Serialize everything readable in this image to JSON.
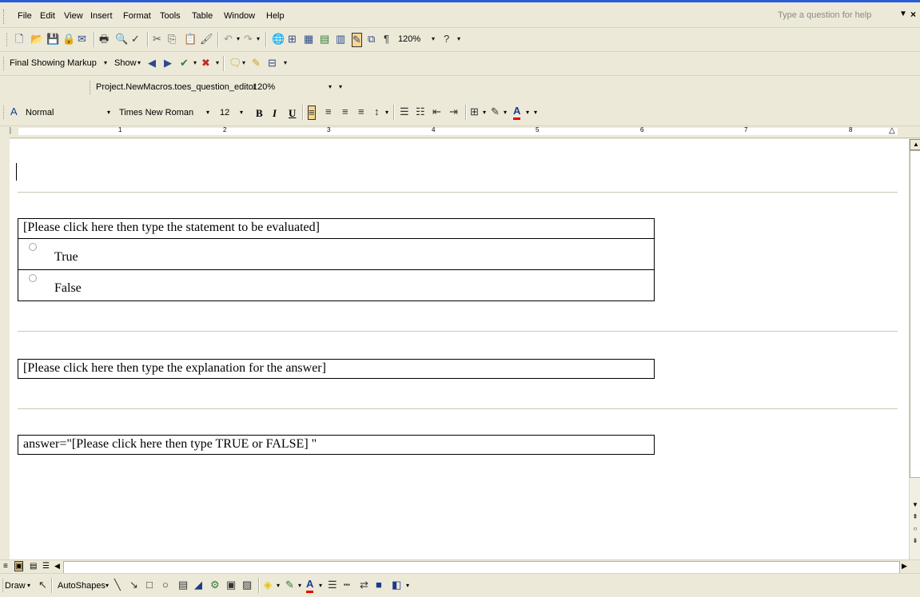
{
  "menu": {
    "items": [
      "File",
      "Edit",
      "View",
      "Insert",
      "Format",
      "Tools",
      "Table",
      "Window",
      "Help"
    ],
    "help_placeholder": "Type a question for help"
  },
  "standard_toolbar": {
    "zoom": "120%"
  },
  "reviewing_toolbar": {
    "display_mode": "Final Showing Markup",
    "show_label": "Show"
  },
  "macro_toolbar": {
    "macro_name": "Project.NewMacros.toes_question_editor",
    "zoom": "120%"
  },
  "formatting_toolbar": {
    "style": "Normal",
    "font": "Times New Roman",
    "size": "12",
    "bold": "B",
    "italic": "I",
    "underline": "U"
  },
  "ruler": {
    "numbers": [
      "1",
      "2",
      "3",
      "4",
      "5",
      "6",
      "7",
      "8"
    ]
  },
  "document": {
    "statement_prompt": "[Please click here then type the statement to be evaluated]",
    "option_true": "True",
    "option_false": "False",
    "explanation_prompt": "[Please click here then type the explanation for the answer]",
    "answer_prompt": "answer=\"[Please click here then type TRUE or FALSE] \""
  },
  "drawing_toolbar": {
    "draw_label": "Draw",
    "autoshapes_label": "AutoShapes"
  }
}
